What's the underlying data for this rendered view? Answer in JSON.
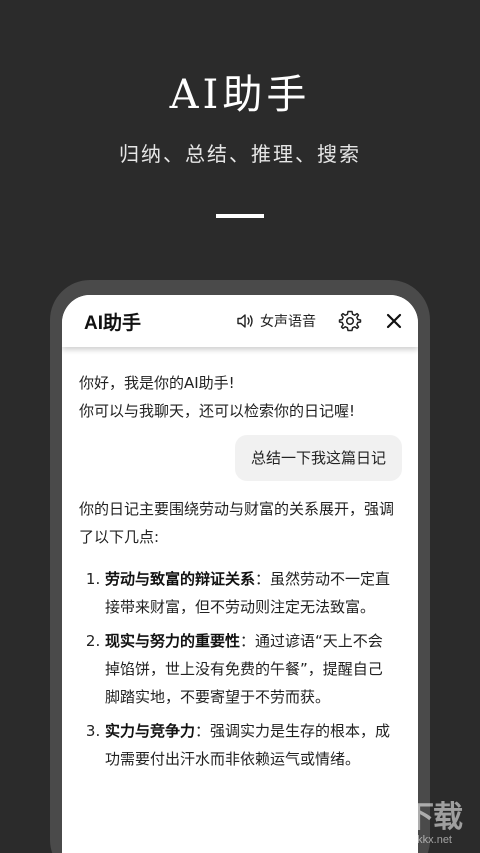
{
  "hero": {
    "title": "AI助手",
    "subtitle": "归纳、总结、推理、搜索"
  },
  "header": {
    "title": "AI助手",
    "voice_label": "女声语音",
    "icons": [
      "speaker-icon",
      "gear-icon",
      "close-icon"
    ]
  },
  "chat": {
    "greeting_line1": "你好，我是你的AI助手!",
    "greeting_line2": "你可以与我聊天，还可以检索你的日记喔!",
    "user_message": "总结一下我这篇日记",
    "reply_intro": "你的日记主要围绕劳动与财富的关系展开，强调了以下几点:",
    "points": [
      {
        "title": "劳动与致富的辩证关系",
        "text": "：虽然劳动不一定直接带来财富，但不劳动则注定无法致富。"
      },
      {
        "title": "现实与努力的重要性",
        "text": "：通过谚语“天上不会掉馅饼，世上没有免费的午餐”，提醒自己脚踏实地，不要寄望于不劳而获。"
      },
      {
        "title": "实力与竞争力",
        "text": "：强调实力是生存的根本，成功需要付出汗水而非依赖运气或情绪。"
      }
    ]
  },
  "watermark": {
    "main": "KK下载",
    "sub": "www.kkx.net"
  }
}
